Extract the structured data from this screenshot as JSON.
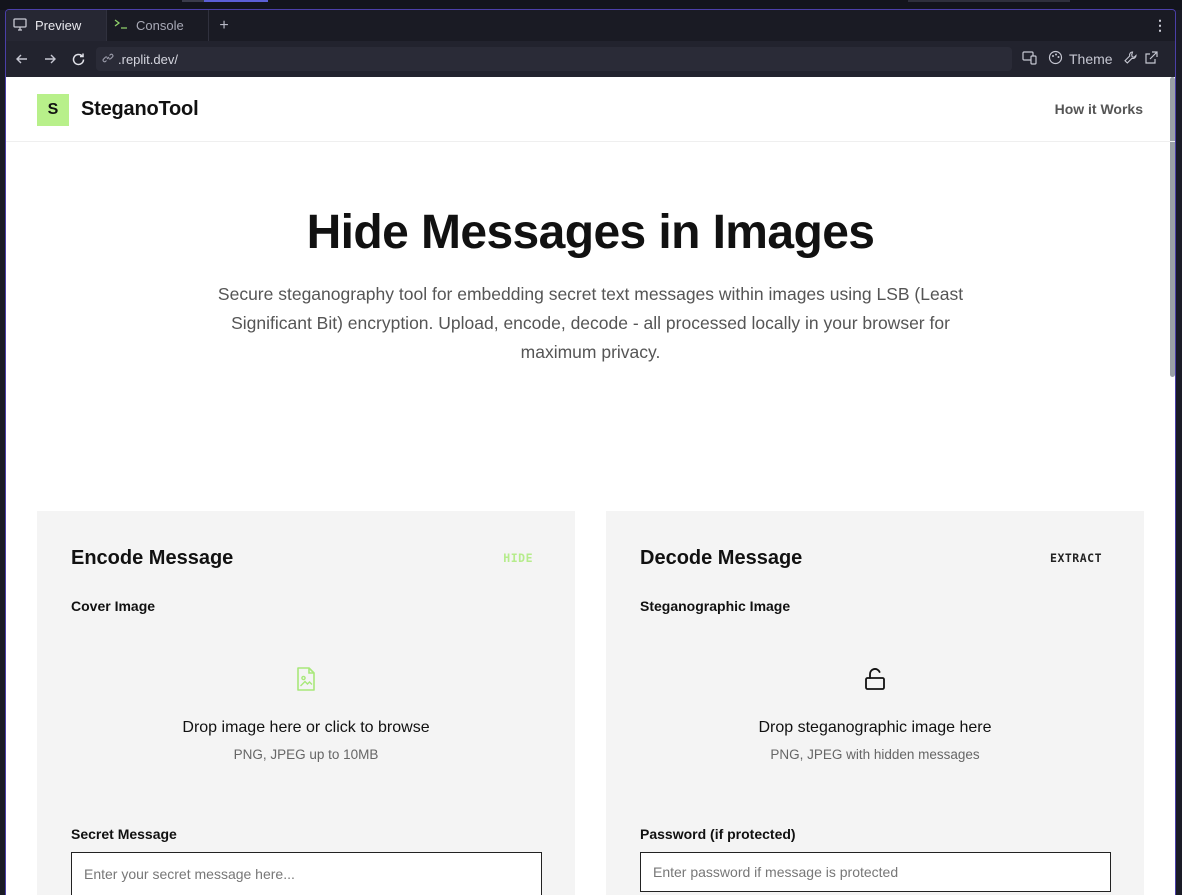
{
  "browser": {
    "tabs": [
      {
        "label": "Preview",
        "icon": "monitor-icon",
        "active": true
      },
      {
        "label": "Console",
        "icon": "terminal-icon",
        "active": false
      }
    ],
    "add_tab_glyph": "+",
    "url": ".replit.dev/",
    "theme_label": "Theme"
  },
  "site": {
    "logo_letter": "S",
    "name": "SteganoTool",
    "nav_link": "How it Works",
    "accent_color": "#b8f08a"
  },
  "hero": {
    "title": "Hide Messages in Images",
    "description": "Secure steganography tool for embedding secret text messages within images using LSB (Least Significant Bit) encryption. Upload, encode, decode - all processed locally in your browser for maximum privacy."
  },
  "encode": {
    "title": "Encode Message",
    "tag": "HIDE",
    "image_label": "Cover Image",
    "drop_title": "Drop image here or click to browse",
    "drop_hint": "PNG, JPEG up to 10MB",
    "message_label": "Secret Message",
    "message_placeholder": "Enter your secret message here..."
  },
  "decode": {
    "title": "Decode Message",
    "tag": "EXTRACT",
    "image_label": "Steganographic Image",
    "drop_title": "Drop steganographic image here",
    "drop_hint": "PNG, JPEG with hidden messages",
    "password_label": "Password (if protected)",
    "password_placeholder": "Enter password if message is protected"
  }
}
